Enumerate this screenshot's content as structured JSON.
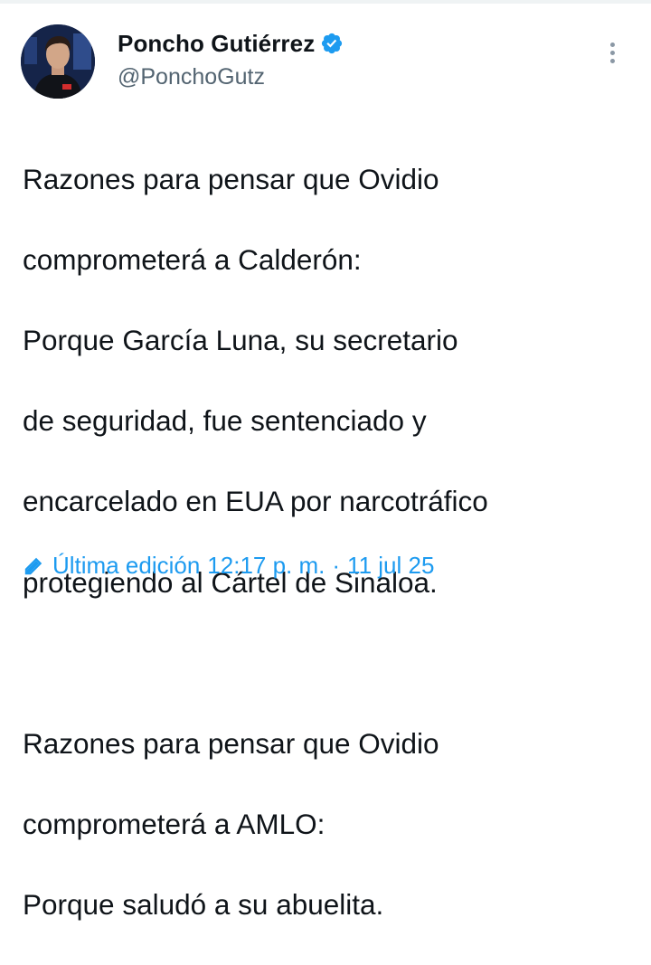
{
  "author": {
    "display_name": "Poncho Gutiérrez",
    "handle": "@PonchoGutz",
    "verified": true,
    "avatar_icon": "profile-photo",
    "verified_icon": "verified-badge-icon",
    "verified_color": "#1d9bf0"
  },
  "menu_icon": "more-vertical-icon",
  "tweet": {
    "lines_block1": [
      "Razones para pensar que Ovidio",
      "comprometerá a Calderón:",
      "Porque García Luna, su secretario",
      "de seguridad, fue sentenciado y",
      "encarcelado en EUA por narcotráfico",
      "protegiendo al Cártel de Sinaloa."
    ],
    "lines_block2": [
      "Razones para pensar que Ovidio",
      "comprometerá a AMLO:",
      "Porque saludó a su abuelita."
    ]
  },
  "edit": {
    "label": "Última edición",
    "time": "12:17 p. m.",
    "separator": "·",
    "date": "11 jul 25",
    "icon": "pencil-icon",
    "color": "#1d9bf0"
  }
}
